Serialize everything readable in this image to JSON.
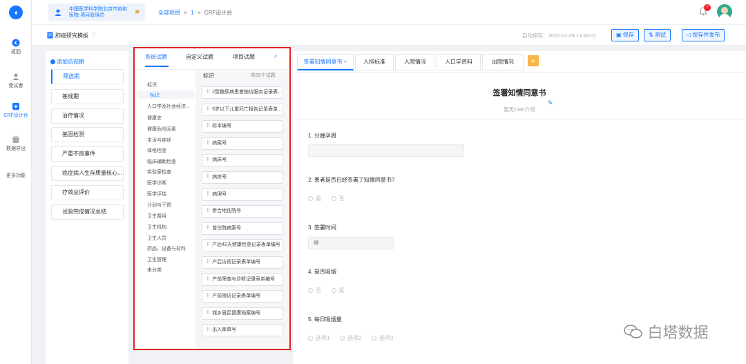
{
  "rail": {
    "items": [
      {
        "label": "返回"
      },
      {
        "label": "受试者"
      },
      {
        "label": "CRF设计台"
      },
      {
        "label": "数据导出"
      },
      {
        "label": "更多功能"
      }
    ]
  },
  "header": {
    "org_line1": "中国医学科学院北京市协和",
    "org_line2": "医院-项目管理员",
    "breadcrumb": [
      "全部项目",
      ">",
      "1",
      ">",
      "CRF设计台"
    ],
    "notification_count": "7"
  },
  "subheader": {
    "template_name": "肺癌研究模板",
    "autosave": "自动保存：2022-12-29 13:43:01",
    "save_label": "保存",
    "test_label": "测试",
    "publish_label": "保存并发布"
  },
  "visits": {
    "add_label": "添加访视期",
    "items": [
      "筛选期",
      "基线期",
      "治疗情况",
      "基因检测",
      "严重不良事件",
      "癌症病人生存质量核心...",
      "疗效总评价",
      "试验完成情况总结"
    ]
  },
  "bank": {
    "tabs": [
      "系统试题",
      "自定义试题",
      "项目试题"
    ],
    "list_title": "标识",
    "count_label": "共99个试题",
    "categories": [
      "标识",
      "标识",
      "人口学及社会经济...",
      "健康史",
      "健康危险因素",
      "主诉与症状",
      "体格检查",
      "临床辅助检查",
      "实验室检查",
      "医学诊断",
      "医学评估",
      "计划与干预",
      "卫生费用",
      "卫生机构",
      "卫生人员",
      "药品、设备与材料",
      "卫生管理",
      "未分类"
    ],
    "questions": [
      "2型糖尿病患者随访服务记录表...",
      "5岁以下儿童死亡报告记录表单...",
      "标本编号",
      "病案号",
      "病床号",
      "病房号",
      "病理号",
      "参合地住院号",
      "曾住院病案号",
      "产后42天健康检查记录表单编号",
      "产后访视记录表单编号",
      "产前筛查与诊断记录表单编号",
      "产前随访记录表单编号",
      "城乡居民健康档案编号",
      "出入库单号"
    ]
  },
  "form": {
    "tabs": [
      "签署知情同意书",
      "入排标准",
      "入院情况",
      "人口学资料",
      "出院情况"
    ],
    "add_tab_label": "+",
    "title": "签署知情同意书",
    "subtitle": "暂无CRF介绍",
    "q1": "1. 分娩孕周",
    "q2": "2. 患者是否已经签署了知情同意书?",
    "q2_opts": [
      "是",
      "否"
    ],
    "q3": "3. 签署时间",
    "q4": "4. 是否吸烟",
    "q4_opts": [
      "否",
      "是"
    ],
    "q5": "5. 每日吸烟量",
    "q5_opts": [
      "选项1",
      "选项2",
      "选项3"
    ]
  },
  "watermark": "白塔数据",
  "colors": {
    "accent": "#1677ff",
    "highlight_border": "#e02020",
    "add_tab": "#f7b54a"
  }
}
